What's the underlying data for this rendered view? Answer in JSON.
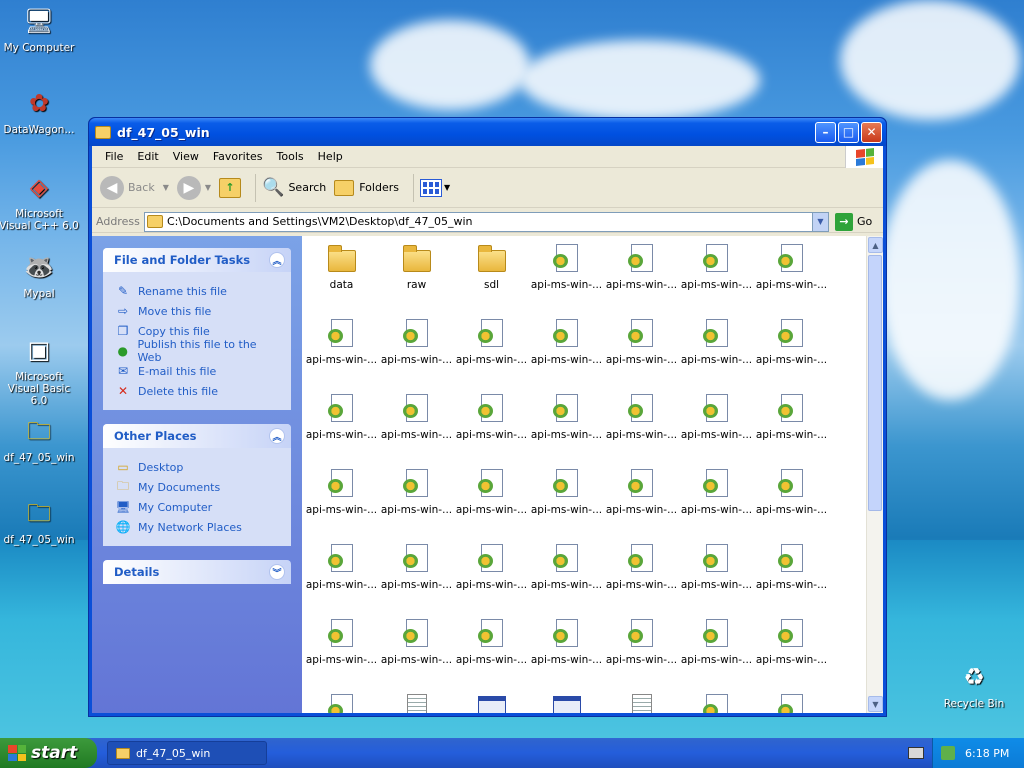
{
  "desktop": {
    "icons": [
      {
        "label": "My Computer"
      },
      {
        "label": "DataWagon..."
      },
      {
        "label": "Microsoft Visual C++ 6.0"
      },
      {
        "label": "Mypal"
      },
      {
        "label": "Microsoft Visual Basic 6.0"
      },
      {
        "label": "df_47_05_win"
      },
      {
        "label": "df_47_05_win"
      },
      {
        "label": "Recycle Bin"
      }
    ]
  },
  "window": {
    "title": "df_47_05_win",
    "menu": [
      "File",
      "Edit",
      "View",
      "Favorites",
      "Tools",
      "Help"
    ],
    "toolbar": {
      "back": "Back",
      "search": "Search",
      "folders": "Folders"
    },
    "address": {
      "label": "Address",
      "value": "C:\\Documents and Settings\\VM2\\Desktop\\df_47_05_win",
      "go": "Go"
    },
    "tasks": {
      "title": "File and Folder Tasks",
      "items": [
        "Rename this file",
        "Move this file",
        "Copy this file",
        "Publish this file to the Web",
        "E-mail this file",
        "Delete this file"
      ]
    },
    "other_places": {
      "title": "Other Places",
      "items": [
        "Desktop",
        "My Documents",
        "My Computer",
        "My Network Places"
      ]
    },
    "details": {
      "title": "Details"
    },
    "files": [
      {
        "name": "data",
        "type": "folder"
      },
      {
        "name": "raw",
        "type": "folder"
      },
      {
        "name": "sdl",
        "type": "folder"
      },
      {
        "name": "api-ms-win-...",
        "type": "dll"
      },
      {
        "name": "api-ms-win-...",
        "type": "dll"
      },
      {
        "name": "api-ms-win-...",
        "type": "dll"
      },
      {
        "name": "api-ms-win-...",
        "type": "dll"
      },
      {
        "name": "api-ms-win-...",
        "type": "dll"
      },
      {
        "name": "api-ms-win-...",
        "type": "dll"
      },
      {
        "name": "api-ms-win-...",
        "type": "dll"
      },
      {
        "name": "api-ms-win-...",
        "type": "dll"
      },
      {
        "name": "api-ms-win-...",
        "type": "dll"
      },
      {
        "name": "api-ms-win-...",
        "type": "dll"
      },
      {
        "name": "api-ms-win-...",
        "type": "dll"
      },
      {
        "name": "api-ms-win-...",
        "type": "dll"
      },
      {
        "name": "api-ms-win-...",
        "type": "dll"
      },
      {
        "name": "api-ms-win-...",
        "type": "dll"
      },
      {
        "name": "api-ms-win-...",
        "type": "dll"
      },
      {
        "name": "api-ms-win-...",
        "type": "dll"
      },
      {
        "name": "api-ms-win-...",
        "type": "dll"
      },
      {
        "name": "api-ms-win-...",
        "type": "dll"
      },
      {
        "name": "api-ms-win-...",
        "type": "dll"
      },
      {
        "name": "api-ms-win-...",
        "type": "dll"
      },
      {
        "name": "api-ms-win-...",
        "type": "dll"
      },
      {
        "name": "api-ms-win-...",
        "type": "dll"
      },
      {
        "name": "api-ms-win-...",
        "type": "dll"
      },
      {
        "name": "api-ms-win-...",
        "type": "dll"
      },
      {
        "name": "api-ms-win-...",
        "type": "dll"
      },
      {
        "name": "api-ms-win-...",
        "type": "dll"
      },
      {
        "name": "api-ms-win-...",
        "type": "dll"
      },
      {
        "name": "api-ms-win-...",
        "type": "dll"
      },
      {
        "name": "api-ms-win-...",
        "type": "dll"
      },
      {
        "name": "api-ms-win-...",
        "type": "dll"
      },
      {
        "name": "api-ms-win-...",
        "type": "dll"
      },
      {
        "name": "api-ms-win-...",
        "type": "dll"
      },
      {
        "name": "api-ms-win-...",
        "type": "dll"
      },
      {
        "name": "api-ms-win-...",
        "type": "dll"
      },
      {
        "name": "api-ms-win-...",
        "type": "dll"
      },
      {
        "name": "api-ms-win-...",
        "type": "dll"
      },
      {
        "name": "api-ms-win-...",
        "type": "dll"
      },
      {
        "name": "api-ms-win-...",
        "type": "dll"
      },
      {
        "name": "api-ms-win-...",
        "type": "dll"
      },
      {
        "name": "",
        "type": "dll"
      },
      {
        "name": "",
        "type": "txt"
      },
      {
        "name": "",
        "type": "exe"
      },
      {
        "name": "",
        "type": "exe"
      },
      {
        "name": "",
        "type": "txt"
      },
      {
        "name": "",
        "type": "dll"
      },
      {
        "name": "",
        "type": "dll"
      }
    ]
  },
  "taskbar": {
    "start": "start",
    "task": "df_47_05_win",
    "clock": "6:18 PM"
  }
}
